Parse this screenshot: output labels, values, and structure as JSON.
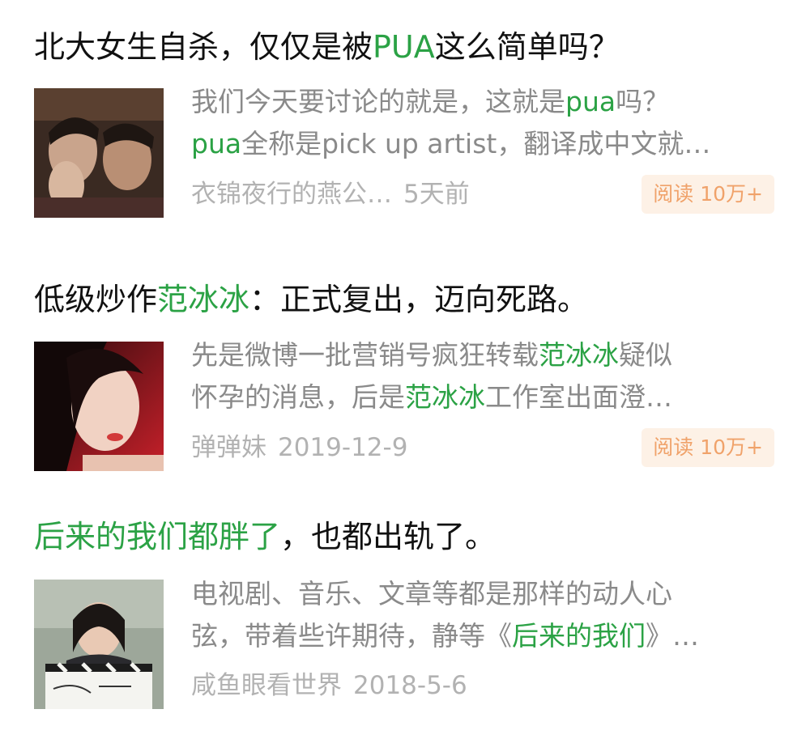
{
  "articles": [
    {
      "title_parts": [
        "北大女生自杀，仅仅是被",
        "PUA",
        "这么简单吗？"
      ],
      "summary_line1_parts": [
        "我们今天要讨论的就是，这就是",
        "pua",
        "吗？"
      ],
      "summary_line2_parts": [
        "pua",
        "全称是pick up artist，翻译成中文就…"
      ],
      "author": "衣锦夜行的燕公…",
      "date": "5天前",
      "read_label": "阅读 10万+",
      "thumbnail_icon": "two-faces-photo-icon"
    },
    {
      "title_parts": [
        "低级炒作",
        "范冰冰",
        "：正式复出，迈向死路。"
      ],
      "summary_line1_parts": [
        "先是微博一批营销号疯狂转载",
        "范冰冰",
        "疑似"
      ],
      "summary_line2_parts": [
        "怀孕的消息，后是",
        "范冰冰",
        "工作室出面澄…"
      ],
      "author": "弹弹妹",
      "date": "2019-12-9",
      "read_label": "阅读 10万+",
      "thumbnail_icon": "woman-portrait-photo-icon"
    },
    {
      "title_parts": [
        "后来的我们都胖了",
        "，也都出轨了。"
      ],
      "summary_line1_parts": [
        "电视剧、音乐、文章等都是那样的动人心"
      ],
      "summary_line2_parts": [
        "弦，带着些许期待，静等《",
        "后来的我们",
        "》…"
      ],
      "author": "咸鱼眼看世界",
      "date": "2018-5-6",
      "thumbnail_icon": "clapperboard-photo-icon"
    }
  ],
  "colors": {
    "highlight": "#2ba245",
    "badge_bg": "#fdf1e6",
    "badge_text": "#f0a26a",
    "meta_text": "#b2b2b2",
    "summary_text": "#8a8a8a"
  }
}
